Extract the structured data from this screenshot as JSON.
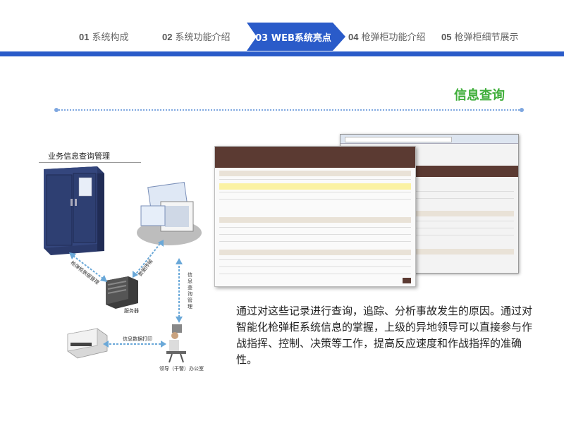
{
  "nav": {
    "items": [
      {
        "num": "01",
        "label": "系统构成"
      },
      {
        "num": "02",
        "label": "系统功能介绍"
      },
      {
        "num": "03",
        "label": "WEB系统亮点"
      },
      {
        "num": "04",
        "label": "枪弹柜功能介绍"
      },
      {
        "num": "05",
        "label": "枪弹柜细节展示"
      }
    ],
    "accent_color": "#2a5bc9"
  },
  "section": {
    "title": "信息查询",
    "title_color": "#3fae3a"
  },
  "diagram": {
    "title": "业务信息查询管理",
    "server_label": "服务器",
    "office_label": "领导（干警）办公室",
    "arrow_cabinet": "枪弹柜数据管理",
    "arrow_data": "数据传输",
    "arrow_query": "信息查询管理",
    "arrow_print": "信息数据打印"
  },
  "paragraph": "通过对这些记录进行查询，追踪、分析事故发生的原因。通过对智能化枪弹柜系统信息的掌握，上级的异地领导可以直接参与作战指挥、控制、决策等工作，提高反应速度和作战指挥的准确性。"
}
